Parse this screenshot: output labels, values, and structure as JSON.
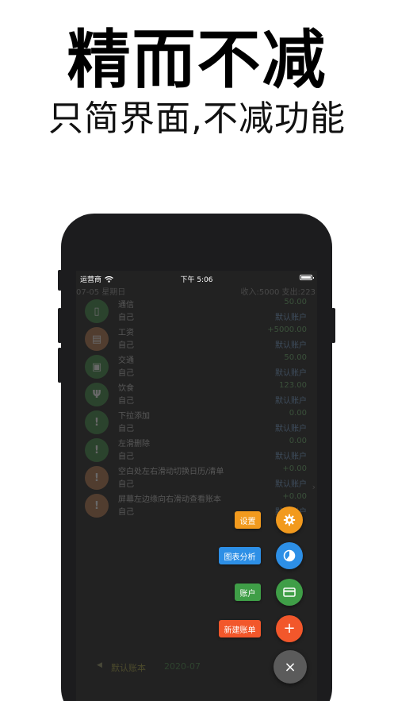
{
  "headline": "精而不减",
  "subline": "只简界面,不减功能",
  "status_bar": {
    "carrier": "运营商",
    "time": "下午 5:06"
  },
  "summary": {
    "date": "07-05 星期日",
    "totals": "收入:5000 支出:223"
  },
  "transactions": [
    {
      "category": "通信",
      "owner": "自己",
      "amount": "50.00",
      "account": "默认账户",
      "icon": "phone-icon",
      "color": "#3f8a45",
      "glyph": "▯"
    },
    {
      "category": "工资",
      "owner": "自己",
      "amount": "+5000.00",
      "account": "默认账户",
      "icon": "salary-icon",
      "color": "#b8774d",
      "glyph": "▤"
    },
    {
      "category": "交通",
      "owner": "自己",
      "amount": "50.00",
      "account": "默认账户",
      "icon": "bus-icon",
      "color": "#3f8a45",
      "glyph": "▣"
    },
    {
      "category": "饮食",
      "owner": "自己",
      "amount": "123.00",
      "account": "默认账户",
      "icon": "utensils-icon",
      "color": "#3f8a45",
      "glyph": "Ψ"
    },
    {
      "category": "下拉添加",
      "owner": "自己",
      "amount": "0.00",
      "account": "默认账户",
      "icon": "exclamation-icon",
      "color": "#3f8a45",
      "glyph": "!"
    },
    {
      "category": "左滑删除",
      "owner": "自己",
      "amount": "0.00",
      "account": "默认账户",
      "icon": "exclamation-icon",
      "color": "#3f8a45",
      "glyph": "!"
    },
    {
      "category": "空白处左右滑动切换日历/清单",
      "owner": "自己",
      "amount": "+0.00",
      "account": "默认账户",
      "icon": "exclamation-icon",
      "color": "#b8774d",
      "glyph": "!"
    },
    {
      "category": "屏幕左边缘向右滑动查看账本",
      "owner": "自己",
      "amount": "+0.00",
      "account": "默认账户",
      "icon": "exclamation-icon",
      "color": "#b8774d",
      "glyph": "!"
    }
  ],
  "footer": {
    "book": "默认账本",
    "month": "2020-07"
  },
  "fab_menu": {
    "settings": {
      "label": "设置",
      "color": "#f29a1e"
    },
    "charts": {
      "label": "图表分析",
      "color": "#2d8fe6"
    },
    "accounts": {
      "label": "账户",
      "color": "#3f9e47"
    },
    "new_book": {
      "label": "新建账单",
      "color": "#f2572b"
    },
    "close_glyph": "×",
    "add_glyph": "+"
  }
}
